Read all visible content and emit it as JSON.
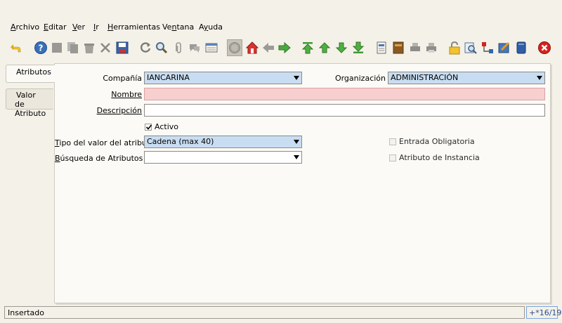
{
  "menu": {
    "items": [
      {
        "pre": "",
        "u": "A",
        "post": "rchivo"
      },
      {
        "pre": "",
        "u": "E",
        "post": "ditar"
      },
      {
        "pre": "",
        "u": "V",
        "post": "er"
      },
      {
        "pre": "",
        "u": "I",
        "post": "r"
      },
      {
        "pre": "",
        "u": "H",
        "post": "erramientas"
      },
      {
        "pre": "Ve",
        "u": "n",
        "post": "tana"
      },
      {
        "pre": "A",
        "u": "y",
        "post": "uda"
      }
    ]
  },
  "tabs": {
    "attributes": "Atributos",
    "values_line1": "Valor",
    "values_line2": "de Atributo"
  },
  "form": {
    "company_label": "Compañía",
    "company_value": "IANCARINA",
    "org_label": "Organización",
    "org_value": "ADMINISTRACIÓN",
    "name_label": "Nombre",
    "name_value": "",
    "desc_label": "Descripción",
    "desc_value": "",
    "active_label": "Activo",
    "active_checked": true,
    "valuetype_label_pre": "",
    "valuetype_label_u": "T",
    "valuetype_label_post": "ipo del valor del atributo",
    "valuetype_value": "Cadena (max 40)",
    "search_label_pre": "",
    "search_label_u": "B",
    "search_label_post": "úsqueda de Atributos",
    "search_value": "",
    "mandatory_label": "Entrada Obligatoria",
    "instance_label": "Atributo de Instancia"
  },
  "status": {
    "message": "Insertado",
    "record_info": "+*16/19"
  },
  "colors": {
    "selected_field": "#c9ddf2",
    "required_field": "#f7cfcf",
    "toolbar_green": "#3fa83a",
    "toolbar_blue": "#2f67b0",
    "close_red": "#d6221e"
  }
}
